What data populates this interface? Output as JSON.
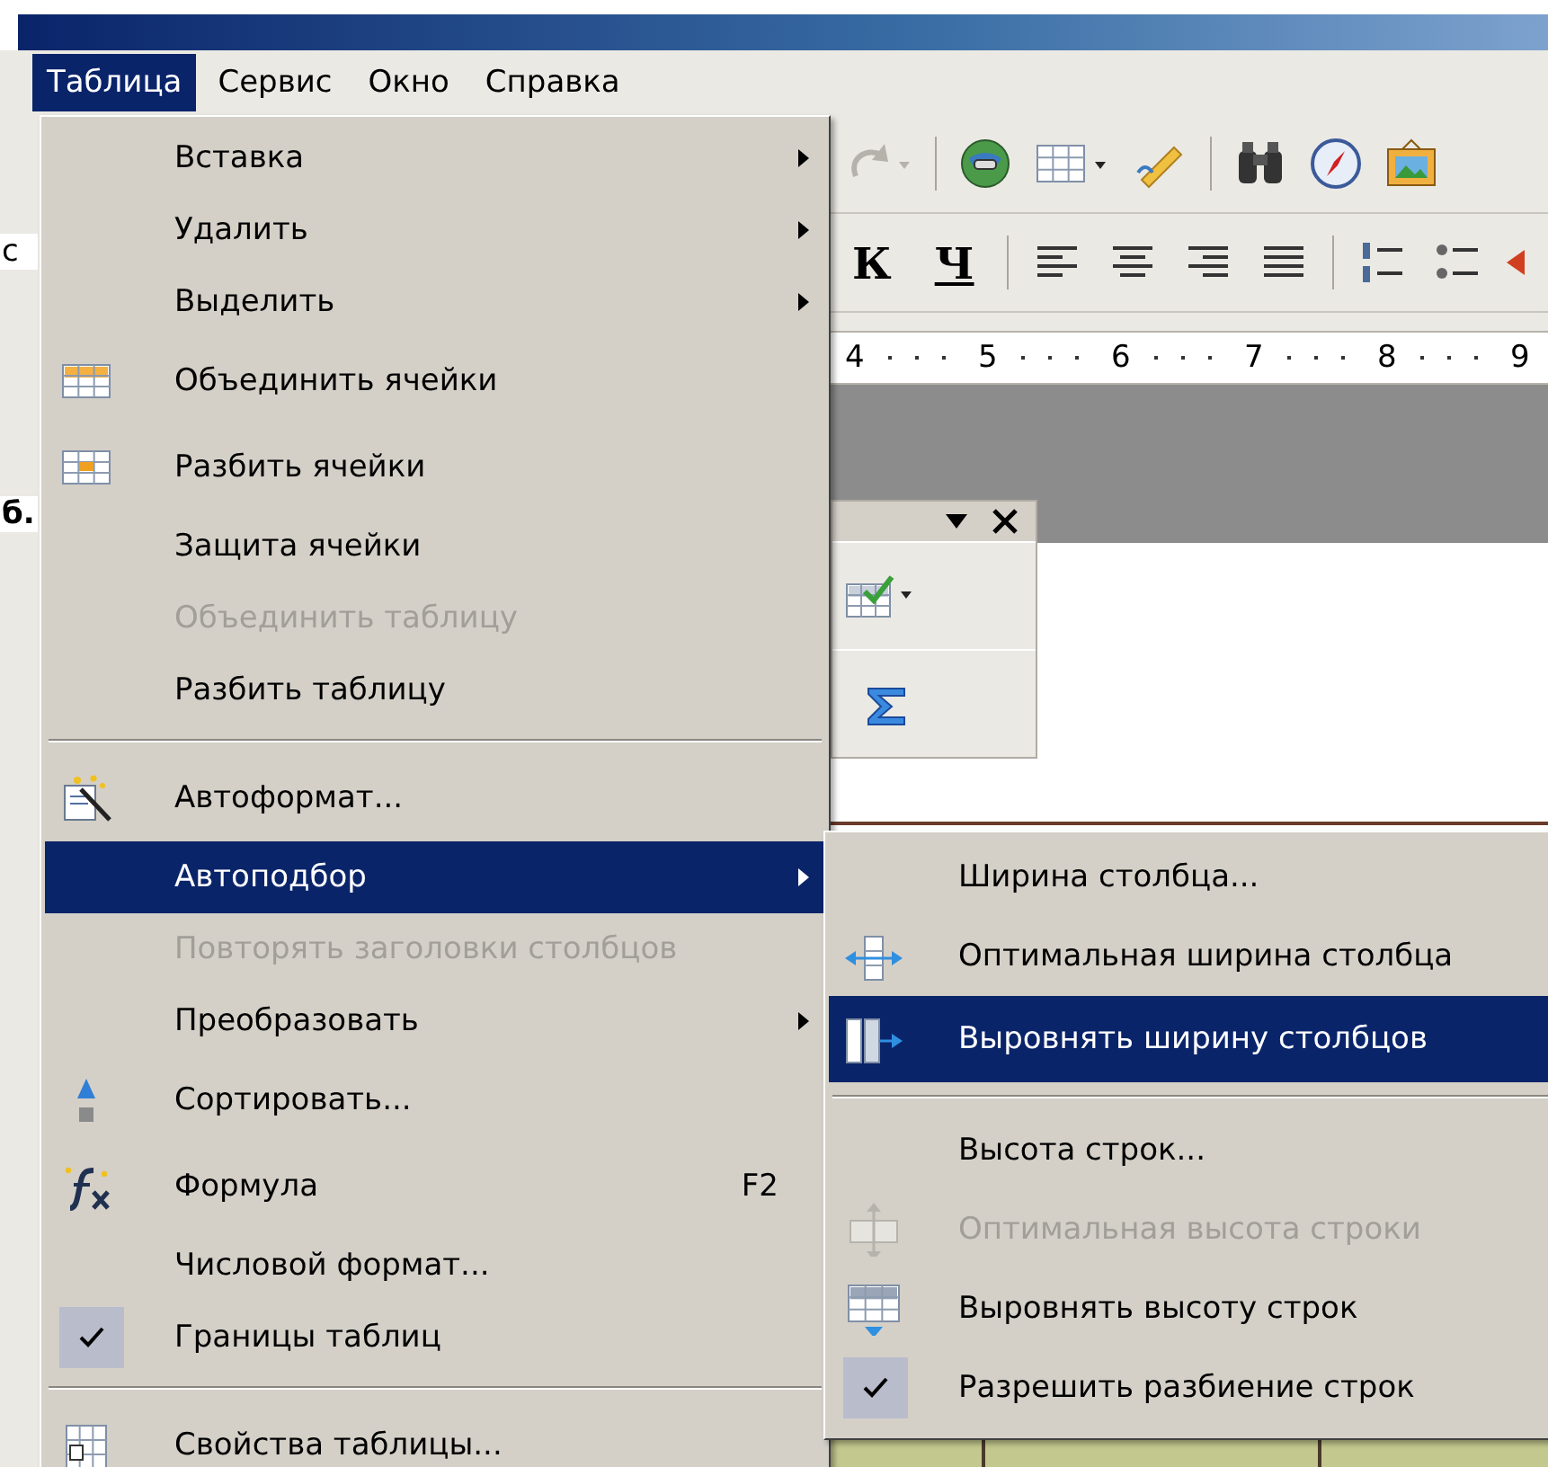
{
  "menubar": [
    {
      "label": "Таблица",
      "selected": true
    },
    {
      "label": "Сервис",
      "selected": false
    },
    {
      "label": "Окно",
      "selected": false
    },
    {
      "label": "Справка",
      "selected": false
    }
  ],
  "formatting_toolbar": {
    "italic_button": "К",
    "underline_button": "Ч"
  },
  "ruler": {
    "numbers": [
      "4",
      "5",
      "6",
      "7",
      "8",
      "9"
    ]
  },
  "left_edge": {
    "fragments": [
      "с",
      "б."
    ]
  },
  "table_menu": {
    "items": [
      {
        "kind": "item",
        "label": "Вставка",
        "submenu": true,
        "disabled": false,
        "selected": false,
        "checked": false
      },
      {
        "kind": "item",
        "label": "Удалить",
        "submenu": true,
        "disabled": false,
        "selected": false,
        "checked": false
      },
      {
        "kind": "item",
        "label": "Выделить",
        "submenu": true,
        "disabled": false,
        "selected": false,
        "checked": false
      },
      {
        "kind": "item",
        "label": "Объединить ячейки",
        "submenu": false,
        "disabled": false,
        "selected": false,
        "checked": false
      },
      {
        "kind": "item",
        "label": "Разбить ячейки",
        "submenu": false,
        "disabled": false,
        "selected": false,
        "checked": false
      },
      {
        "kind": "item",
        "label": "Защита ячейки",
        "submenu": false,
        "disabled": false,
        "selected": false,
        "checked": false
      },
      {
        "kind": "item",
        "label": "Объединить таблицу",
        "submenu": false,
        "disabled": true,
        "selected": false,
        "checked": false
      },
      {
        "kind": "item",
        "label": "Разбить таблицу",
        "submenu": false,
        "disabled": false,
        "selected": false,
        "checked": false
      },
      {
        "kind": "separator"
      },
      {
        "kind": "item",
        "label": "Автоформат...",
        "submenu": false,
        "disabled": false,
        "selected": false,
        "checked": false
      },
      {
        "kind": "item",
        "label": "Автоподбор",
        "submenu": true,
        "disabled": false,
        "selected": true,
        "checked": false
      },
      {
        "kind": "item",
        "label": "Повторять заголовки столбцов",
        "submenu": false,
        "disabled": true,
        "selected": false,
        "checked": false
      },
      {
        "kind": "item",
        "label": "Преобразовать",
        "submenu": true,
        "disabled": false,
        "selected": false,
        "checked": false
      },
      {
        "kind": "item",
        "label": "Сортировать...",
        "submenu": false,
        "disabled": false,
        "selected": false,
        "checked": false
      },
      {
        "kind": "item",
        "label": "Формула",
        "shortcut": "F2",
        "submenu": false,
        "disabled": false,
        "selected": false,
        "checked": false
      },
      {
        "kind": "item",
        "label": "Числовой формат...",
        "submenu": false,
        "disabled": false,
        "selected": false,
        "checked": false
      },
      {
        "kind": "item",
        "label": "Границы таблиц",
        "submenu": false,
        "disabled": false,
        "selected": false,
        "checked": true
      },
      {
        "kind": "separator"
      },
      {
        "kind": "item",
        "label": "Свойства таблицы...",
        "submenu": false,
        "disabled": false,
        "selected": false,
        "checked": false
      }
    ]
  },
  "autofit_submenu": {
    "items": [
      {
        "kind": "item",
        "label": "Ширина столбца...",
        "disabled": false,
        "selected": false,
        "checked": false
      },
      {
        "kind": "item",
        "label": "Оптимальная ширина столбца",
        "disabled": false,
        "selected": false,
        "checked": false
      },
      {
        "kind": "item",
        "label": "Выровнять ширину столбцов",
        "disabled": false,
        "selected": true,
        "checked": false
      },
      {
        "kind": "separator"
      },
      {
        "kind": "item",
        "label": "Высота строк...",
        "disabled": false,
        "selected": false,
        "checked": false
      },
      {
        "kind": "item",
        "label": "Оптимальная высота строки",
        "disabled": true,
        "selected": false,
        "checked": false
      },
      {
        "kind": "item",
        "label": "Выровнять высоту строк",
        "disabled": false,
        "selected": false,
        "checked": false
      },
      {
        "kind": "item",
        "label": "Разрешить разбиение строк",
        "disabled": false,
        "selected": false,
        "checked": true
      }
    ]
  }
}
